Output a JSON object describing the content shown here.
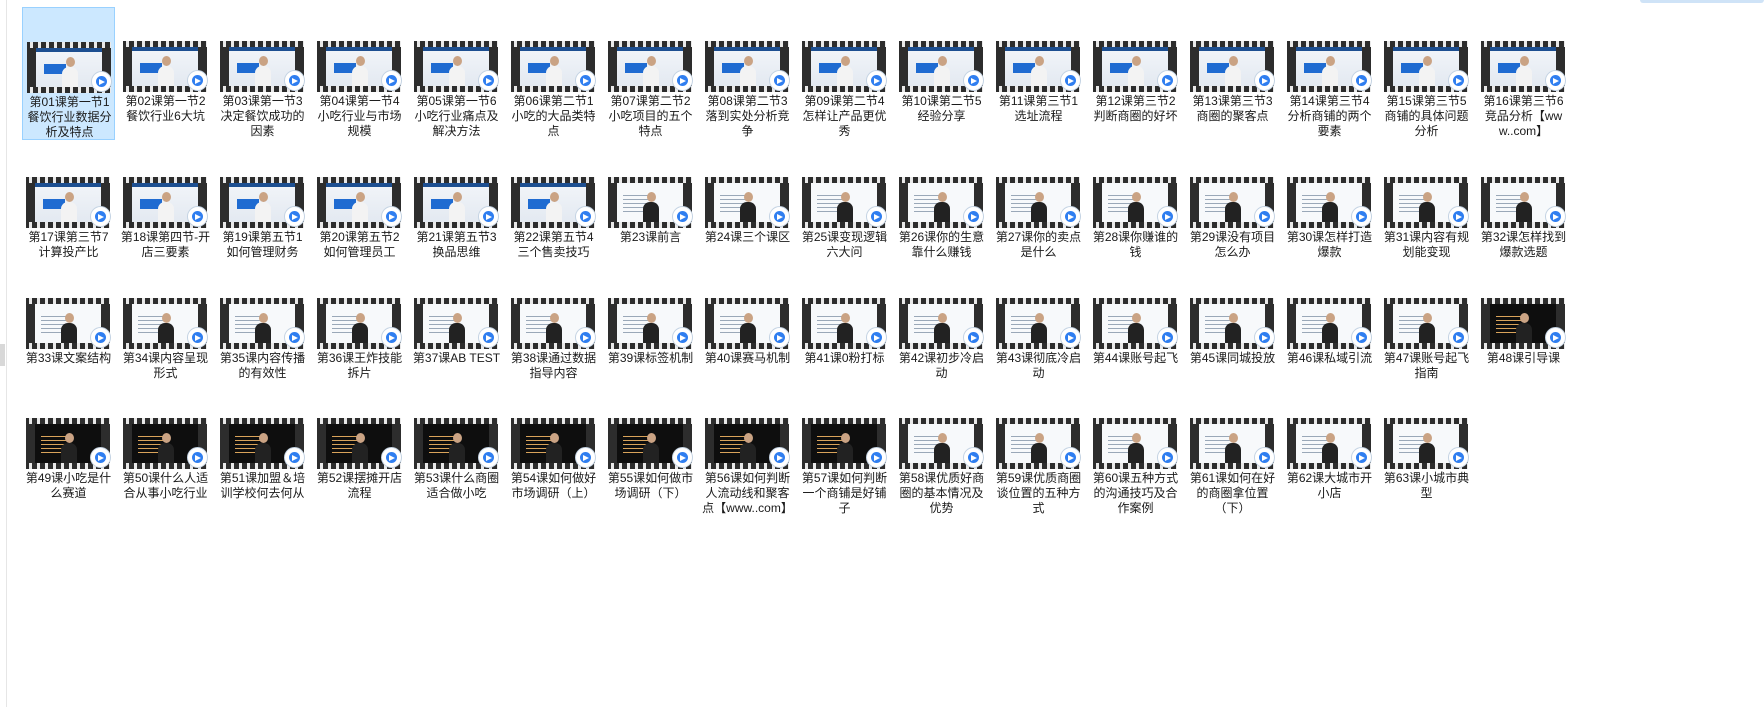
{
  "files": [
    {
      "label": "第01课第一节1餐饮行业数据分析及特点",
      "style": "slide",
      "selected": true
    },
    {
      "label": "第02课第一节2餐饮行业6大坑",
      "style": "slide"
    },
    {
      "label": "第03课第一节3决定餐饮成功的因素",
      "style": "slide"
    },
    {
      "label": "第04课第一节4小吃行业与市场规模",
      "style": "slide"
    },
    {
      "label": "第05课第一节6小吃行业痛点及解决方法",
      "style": "slide"
    },
    {
      "label": "第06课第二节1小吃的大品类特点",
      "style": "slide"
    },
    {
      "label": "第07课第二节2小吃项目的五个特点",
      "style": "slide"
    },
    {
      "label": "第08课第二节3落到实处分析竞争",
      "style": "slide"
    },
    {
      "label": "第09课第二节4怎样让产品更优秀",
      "style": "slide"
    },
    {
      "label": "第10课第二节5经验分享",
      "style": "slide"
    },
    {
      "label": "第11课第三节1选址流程",
      "style": "slide"
    },
    {
      "label": "第12课第三节2判断商圈的好坏",
      "style": "slide"
    },
    {
      "label": "第13课第三节3商圈的聚客点",
      "style": "slide"
    },
    {
      "label": "第14课第三节4分析商铺的两个要素",
      "style": "slide"
    },
    {
      "label": "第15课第三节5商铺的具体问题分析",
      "style": "slide"
    },
    {
      "label": "第16课第三节6竞品分析【www..com】",
      "style": "slide"
    },
    {
      "label": "第17课第三节7计算投产比",
      "style": "slide"
    },
    {
      "label": "第18课第四节-开店三要素",
      "style": "slide"
    },
    {
      "label": "第19课第五节1如何管理财务",
      "style": "slide"
    },
    {
      "label": "第20课第五节2如何管理员工",
      "style": "slide"
    },
    {
      "label": "第21课第五节3换品思维",
      "style": "slide"
    },
    {
      "label": "第22课第五节4三个售卖技巧",
      "style": "slide"
    },
    {
      "label": "第23课前言",
      "style": "doc"
    },
    {
      "label": "第24课三个课区",
      "style": "doc"
    },
    {
      "label": "第25课变现逻辑六大问",
      "style": "doc"
    },
    {
      "label": "第26课你的生意靠什么赚钱",
      "style": "doc"
    },
    {
      "label": "第27课你的卖点是什么",
      "style": "doc"
    },
    {
      "label": "第28课你赚谁的钱",
      "style": "doc"
    },
    {
      "label": "第29课没有项目怎么办",
      "style": "doc"
    },
    {
      "label": "第30课怎样打造爆款",
      "style": "doc"
    },
    {
      "label": "第31课内容有规划能变现",
      "style": "doc"
    },
    {
      "label": "第32课怎样找到爆款选题",
      "style": "doc"
    },
    {
      "label": "第33课文案结构",
      "style": "doc"
    },
    {
      "label": "第34课内容呈现形式",
      "style": "doc"
    },
    {
      "label": "第35课内容传播的有效性",
      "style": "doc"
    },
    {
      "label": "第36课王炸技能拆片",
      "style": "doc"
    },
    {
      "label": "第37课AB TEST",
      "style": "doc"
    },
    {
      "label": "第38课通过数据指导内容",
      "style": "doc"
    },
    {
      "label": "第39课标签机制",
      "style": "doc"
    },
    {
      "label": "第40课赛马机制",
      "style": "doc"
    },
    {
      "label": "第41课0粉打标",
      "style": "doc"
    },
    {
      "label": "第42课初步冷启动",
      "style": "doc"
    },
    {
      "label": "第43课彻底冷启动",
      "style": "doc"
    },
    {
      "label": "第44课账号起飞",
      "style": "doc"
    },
    {
      "label": "第45课同城投放",
      "style": "doc"
    },
    {
      "label": "第46课私域引流",
      "style": "doc"
    },
    {
      "label": "第47课账号起飞指南",
      "style": "doc"
    },
    {
      "label": "第48课引导课",
      "style": "dark"
    },
    {
      "label": "第49课小吃是什么赛道",
      "style": "dark"
    },
    {
      "label": "第50课什么人适合从事小吃行业",
      "style": "dark"
    },
    {
      "label": "第51课加盟＆培训学校何去何从",
      "style": "dark"
    },
    {
      "label": "第52课摆摊开店流程",
      "style": "dark"
    },
    {
      "label": "第53课什么商圈适合做小吃",
      "style": "dark"
    },
    {
      "label": "第54课如何做好市场调研（上）",
      "style": "dark"
    },
    {
      "label": "第55课如何做市场调研（下）",
      "style": "dark"
    },
    {
      "label": "第56课如何判断人流动线和聚客点【www..com】",
      "style": "dark"
    },
    {
      "label": "第57课如何判断一个商铺是好铺子",
      "style": "dark"
    },
    {
      "label": "第58课优质好商圈的基本情况及优势",
      "style": "doc"
    },
    {
      "label": "第59课优质商圈谈位置的五种方式",
      "style": "doc"
    },
    {
      "label": "第60课五种方式的沟通技巧及合作案例",
      "style": "doc"
    },
    {
      "label": "第61课如何在好的商圈拿位置（下）",
      "style": "doc"
    },
    {
      "label": "第62课大城市开小店",
      "style": "doc"
    },
    {
      "label": "第63课小城市典型",
      "style": "doc"
    }
  ]
}
